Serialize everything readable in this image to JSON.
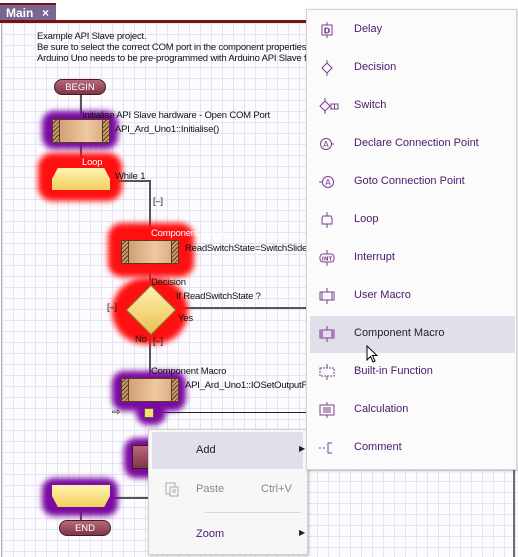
{
  "tab": {
    "title": "Main",
    "close_icon": "×"
  },
  "canvas": {
    "comment_lines": [
      "Example API Slave project.",
      "Be sure to select the correct COM port in the component properties.",
      "Arduino Uno needs to be pre-programmed with Arduino API Slave fi"
    ],
    "begin_label": "BEGIN",
    "end_label": "END",
    "init_macro": {
      "title": "Initialise API Slave hardware - Open COM Port",
      "call": "API_Ard_Uno1::Initialise()"
    },
    "loop": {
      "title": "Loop",
      "condition": "While 1",
      "collapse": "[–]"
    },
    "read_macro": {
      "title": "Component Macro",
      "call": "ReadSwitchState=SwitchSlide"
    },
    "decision": {
      "title": "Decision",
      "condition": "If  ReadSwitchState ?",
      "yes": "Yes",
      "no": "No",
      "collapse_left": "[–]",
      "collapse_no": "[–]"
    },
    "output_macro": {
      "title": "Component Macro",
      "call": "API_Ard_Uno1::IOSetOutputF"
    },
    "insert_arrow": "⇨"
  },
  "context_menu": {
    "items": [
      {
        "label": "Add",
        "submenu_arrow": "▶",
        "highlighted": true
      },
      {
        "label": "Paste",
        "shortcut": "Ctrl+V",
        "disabled": true,
        "icon": "paste-icon"
      },
      {
        "label": "Zoom",
        "submenu_arrow": "▶"
      }
    ]
  },
  "add_submenu": {
    "items": [
      {
        "label": "Delay",
        "icon": "delay-icon"
      },
      {
        "label": "Decision",
        "icon": "decision-icon"
      },
      {
        "label": "Switch",
        "icon": "switch-icon"
      },
      {
        "label": "Declare Connection Point",
        "icon": "declare-connection-point-icon"
      },
      {
        "label": "Goto Connection Point",
        "icon": "goto-connection-point-icon"
      },
      {
        "label": "Loop",
        "icon": "loop-icon"
      },
      {
        "label": "Interrupt",
        "icon": "interrupt-icon"
      },
      {
        "label": "User Macro",
        "icon": "user-macro-icon"
      },
      {
        "label": "Component Macro",
        "icon": "component-macro-icon",
        "highlighted": true
      },
      {
        "label": "Built-in Function",
        "icon": "built-in-function-icon"
      },
      {
        "label": "Calculation",
        "icon": "calculation-icon"
      },
      {
        "label": "Comment",
        "icon": "comment-icon"
      }
    ]
  },
  "colors": {
    "tab_bg": "#7b6591",
    "tab_accent": "#7a1010",
    "menu_text": "#4b1a6b",
    "highlight": "#e0dfea",
    "error_glow": "#ff1010",
    "selection_glow": "#7a0aa0"
  }
}
